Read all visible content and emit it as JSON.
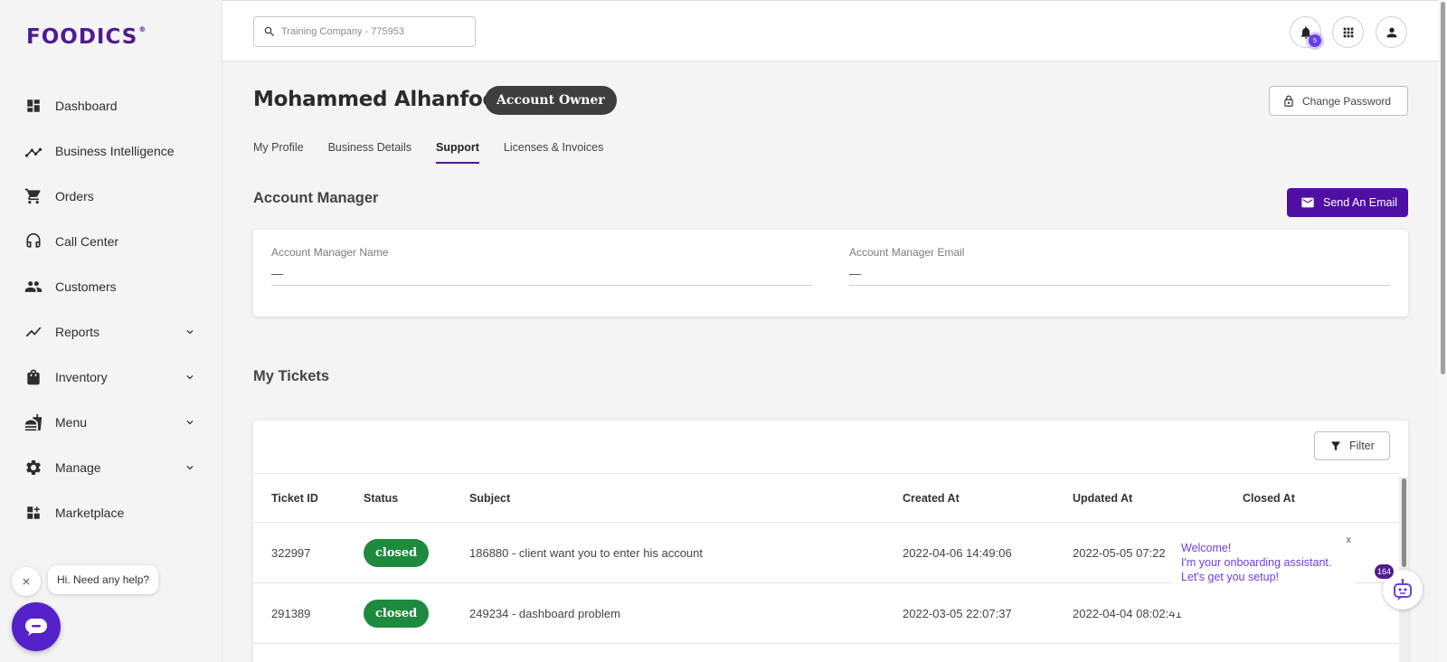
{
  "brand": {
    "logo": "FOODICS",
    "trademark": "®",
    "accent": "#4f1b91"
  },
  "sidebar": {
    "items": [
      {
        "label": "Dashboard",
        "icon": "dashboard-icon",
        "expandable": false
      },
      {
        "label": "Business Intelligence",
        "icon": "analytics-icon",
        "expandable": false
      },
      {
        "label": "Orders",
        "icon": "cart-icon",
        "expandable": false
      },
      {
        "label": "Call Center",
        "icon": "headset-icon",
        "expandable": false
      },
      {
        "label": "Customers",
        "icon": "people-icon",
        "expandable": false
      },
      {
        "label": "Reports",
        "icon": "trending-icon",
        "expandable": true
      },
      {
        "label": "Inventory",
        "icon": "bag-icon",
        "expandable": true
      },
      {
        "label": "Menu",
        "icon": "food-icon",
        "expandable": true
      },
      {
        "label": "Manage",
        "icon": "gear-icon",
        "expandable": true
      },
      {
        "label": "Marketplace",
        "icon": "apps-add-icon",
        "expandable": false
      }
    ]
  },
  "help": {
    "bubble_text": "Hi. Need any help?"
  },
  "topbar": {
    "search_placeholder": "Training Company - 775953",
    "notification_count": "5"
  },
  "profile": {
    "name": "Mohammed Alhanfoosh",
    "role_badge": "Account Owner",
    "change_password_label": "Change Password"
  },
  "tabs": [
    {
      "label": "My Profile",
      "active": false
    },
    {
      "label": "Business Details",
      "active": false
    },
    {
      "label": "Support",
      "active": true
    },
    {
      "label": "Licenses & Invoices",
      "active": false
    }
  ],
  "account_manager": {
    "title": "Account Manager",
    "send_email_label": "Send An Email",
    "name_label": "Account Manager Name",
    "name_value": "—",
    "email_label": "Account Manager Email",
    "email_value": "—"
  },
  "tickets": {
    "title": "My Tickets",
    "filter_label": "Filter",
    "columns": [
      "Ticket ID",
      "Status",
      "Subject",
      "Created At",
      "Updated At",
      "Closed At"
    ],
    "rows": [
      {
        "id": "322997",
        "status": "closed",
        "subject": "186880 - client want you to enter his account",
        "created": "2022-04-06 14:49:06",
        "updated": "2022-05-05 07:22",
        "closed": ""
      },
      {
        "id": "291389",
        "status": "closed",
        "subject": "249234 - dashboard problem",
        "created": "2022-03-05 22:07:37",
        "updated": "2022-04-04 08:02:41",
        "closed": ""
      }
    ],
    "status_color": "#1e8a3d"
  },
  "assistant": {
    "close_label": "x",
    "line1": "Welcome!",
    "line2": "I'm your onboarding assistant.",
    "line3": "Let's get you setup!",
    "badge_count": "164"
  }
}
